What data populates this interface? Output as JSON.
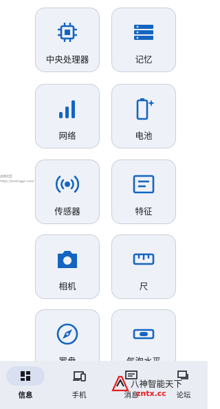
{
  "tiles": [
    {
      "label": "中央处理器",
      "icon": "cpu-icon"
    },
    {
      "label": "记忆",
      "icon": "memory-icon"
    },
    {
      "label": "网络",
      "icon": "signal-bars-icon"
    },
    {
      "label": "电池",
      "icon": "battery-icon"
    },
    {
      "label": "传感器",
      "icon": "sensor-icon"
    },
    {
      "label": "特征",
      "icon": "features-icon"
    },
    {
      "label": "相机",
      "icon": "camera-icon"
    },
    {
      "label": "尺",
      "icon": "ruler-icon"
    },
    {
      "label": "罗盘",
      "icon": "compass-icon"
    },
    {
      "label": "气泡水平",
      "icon": "bubble-level-icon"
    }
  ],
  "watermark": {
    "line1": "高楼社区",
    "line2": "https://bodingge.com/"
  },
  "bottom_nav": [
    {
      "label": "信息",
      "icon": "dashboard-icon",
      "active": true
    },
    {
      "label": "手机",
      "icon": "devices-icon",
      "active": false
    },
    {
      "label": "消息",
      "icon": "message-icon",
      "active": false
    },
    {
      "label": "论坛",
      "icon": "forum-icon",
      "active": false
    }
  ],
  "brand": {
    "line1": "八神智能天下",
    "line2": "zntx.cc"
  },
  "colors": {
    "accent": "#1565c0",
    "tile_bg": "#eef1f7",
    "nav_bg": "#e9ecf3",
    "nav_active": "#d8dff0"
  }
}
